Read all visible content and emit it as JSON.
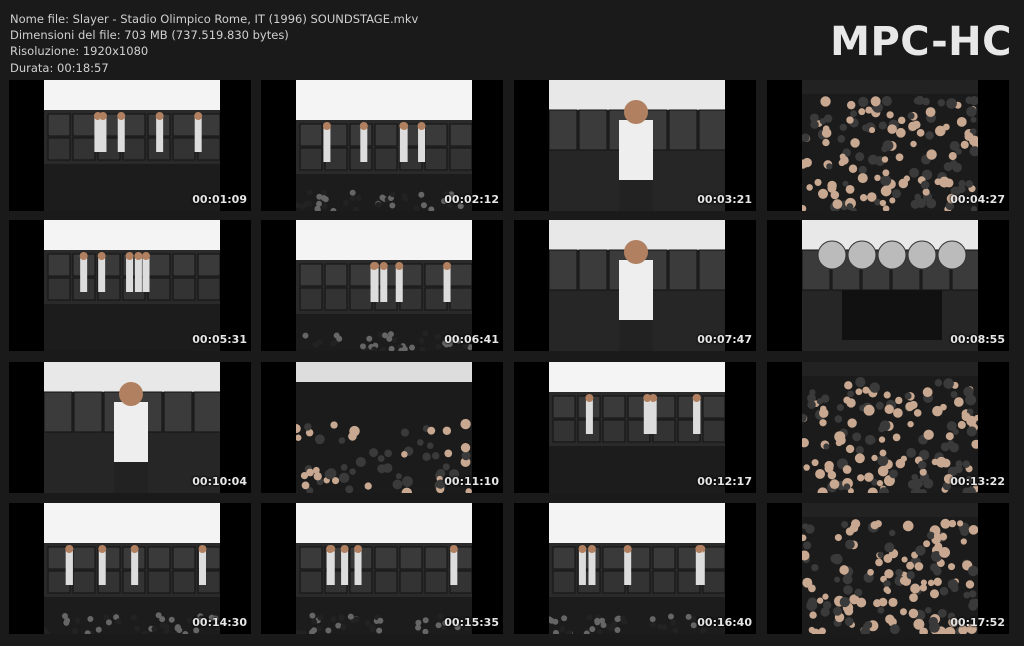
{
  "header": {
    "file_name": "Nome file: Slayer - Stadio Olimpico Rome, IT (1996) SOUNDSTAGE.mkv",
    "file_size": "Dimensioni del file: 703 MB (737.519.830 bytes)",
    "resolution": "Risoluzione: 1920x1080",
    "duration": "Durata: 00:18:57",
    "logo": "MPC-HC"
  },
  "thumbnails": [
    {
      "timestamp": "00:01:09",
      "scene": "stage"
    },
    {
      "timestamp": "00:02:12",
      "scene": "stage-wide"
    },
    {
      "timestamp": "00:03:21",
      "scene": "closeup"
    },
    {
      "timestamp": "00:04:27",
      "scene": "crowd"
    },
    {
      "timestamp": "00:05:31",
      "scene": "stage"
    },
    {
      "timestamp": "00:06:41",
      "scene": "stage-wide"
    },
    {
      "timestamp": "00:07:47",
      "scene": "closeup"
    },
    {
      "timestamp": "00:08:55",
      "scene": "drums"
    },
    {
      "timestamp": "00:10:04",
      "scene": "closeup"
    },
    {
      "timestamp": "00:11:10",
      "scene": "crowd-dark"
    },
    {
      "timestamp": "00:12:17",
      "scene": "stage"
    },
    {
      "timestamp": "00:13:22",
      "scene": "crowd"
    },
    {
      "timestamp": "00:14:30",
      "scene": "stage-wide"
    },
    {
      "timestamp": "00:15:35",
      "scene": "stage-wide"
    },
    {
      "timestamp": "00:16:40",
      "scene": "stage-wide"
    },
    {
      "timestamp": "00:17:52",
      "scene": "crowd"
    }
  ]
}
